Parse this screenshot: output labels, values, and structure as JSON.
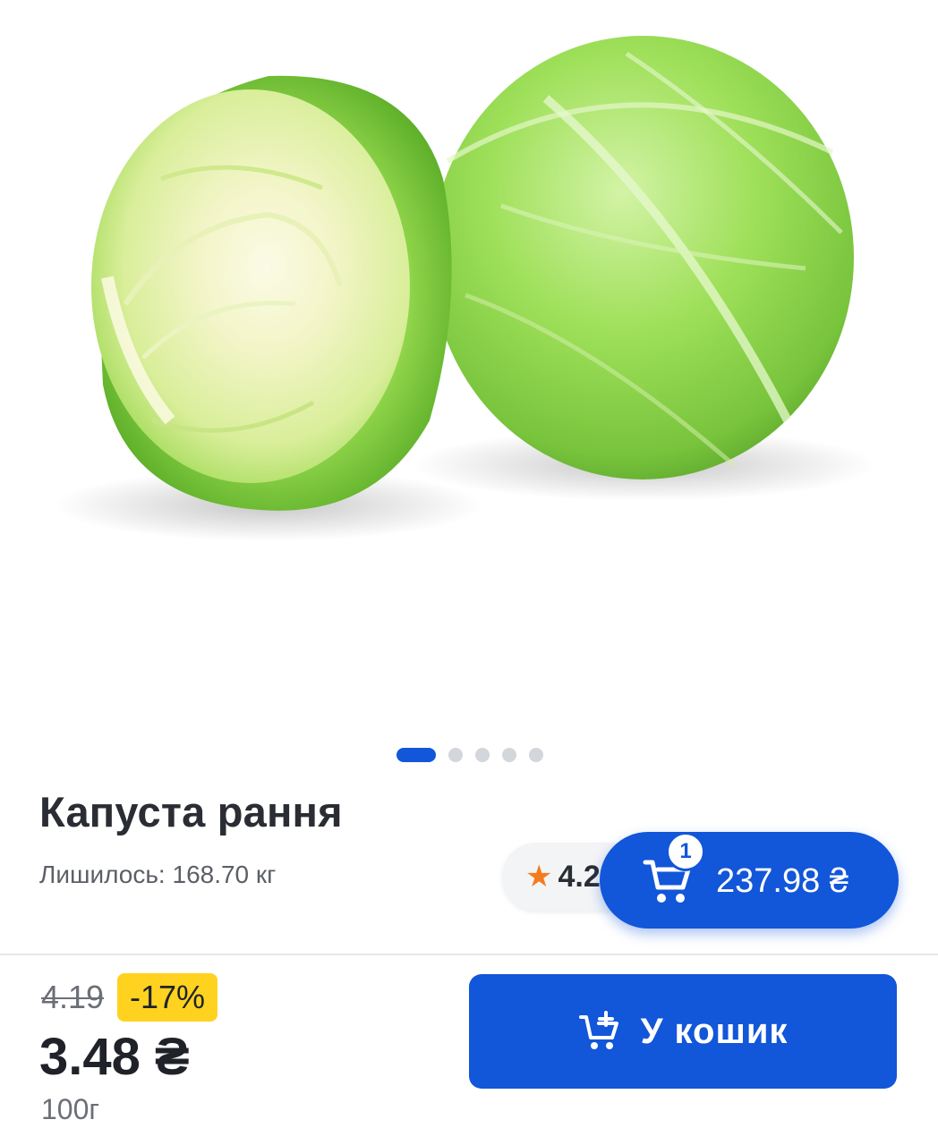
{
  "product": {
    "title": "Капуста рання",
    "stock_text": "Лишилось: 168.70 кг",
    "rating": "4.2",
    "image_name": "cabbage-photo"
  },
  "gallery": {
    "total_images": 5,
    "active_index": 0
  },
  "cart": {
    "count": "1",
    "total": "237.98 ₴"
  },
  "pricing": {
    "old_price": "4.19",
    "discount": "-17%",
    "price": "3.48 ₴",
    "unit": "100г"
  },
  "actions": {
    "add_to_cart_label": "У кошик"
  },
  "colors": {
    "accent": "#1256d9",
    "discount_badge": "#ffd21f",
    "star": "#f47c20"
  }
}
